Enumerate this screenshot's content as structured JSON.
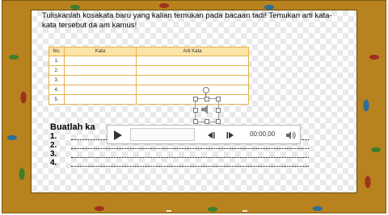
{
  "slide": {
    "instruction_line1": "Tuliskanlah kosakata baru yang kalian temukan pada bacaan tadi!  Temukan arti kata-",
    "instruction_line2": "kata tersebut da am kamus!"
  },
  "table": {
    "headers": [
      "No.",
      "Kata",
      "Arti Kata"
    ],
    "rows": [
      {
        "no": "1."
      },
      {
        "no": "2."
      },
      {
        "no": "3."
      },
      {
        "no": "4."
      },
      {
        "no": "5."
      }
    ]
  },
  "tasks": {
    "heading": "Buatlah ka",
    "items": [
      "1.",
      "2.",
      "3.",
      "4."
    ]
  },
  "player": {
    "time": "00:00,00"
  },
  "icons": {
    "speaker": "speaker-icon",
    "play": "play-icon",
    "back": "skip-back-icon",
    "forward": "skip-forward-icon",
    "volume": "volume-icon"
  }
}
